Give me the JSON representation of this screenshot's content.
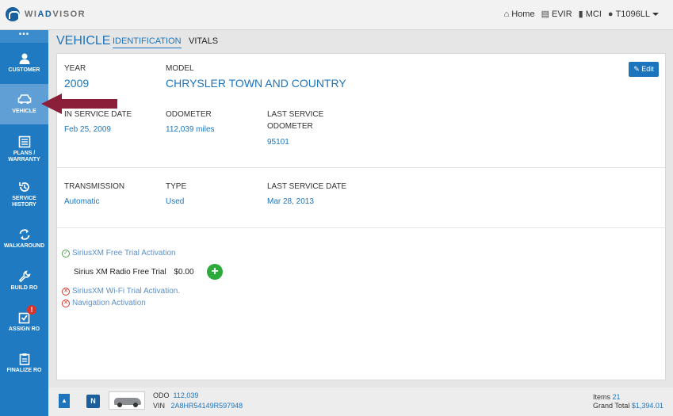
{
  "brand": {
    "name_prefix": "WI",
    "name_accent": "AD",
    "name_suffix": "VISOR"
  },
  "topnav": {
    "home": "Home",
    "evir": "EVIR",
    "mci": "MCI",
    "user": "T1096LL"
  },
  "sidebar": {
    "dots": "•••",
    "items": [
      {
        "label": "CUSTOMER",
        "icon": "person-icon"
      },
      {
        "label": "VEHICLE",
        "icon": "car-icon"
      },
      {
        "label": "PLANS / WARRANTY",
        "icon": "list-icon"
      },
      {
        "label": "SERVICE HISTORY",
        "icon": "history-icon"
      },
      {
        "label": "WALKAROUND",
        "icon": "refresh-icon"
      },
      {
        "label": "BUILD RO",
        "icon": "wrench-icon"
      },
      {
        "label": "ASSIGN RO",
        "icon": "checkbox-icon",
        "badge": "!"
      },
      {
        "label": "FINALIZE RO",
        "icon": "clipboard-icon"
      }
    ]
  },
  "header": {
    "title": "VEHICLE",
    "tabs": [
      "IDENTIFICATION",
      "VITALS"
    ]
  },
  "vehicle": {
    "year_label": "YEAR",
    "year": "2009",
    "model_label": "MODEL",
    "model": "CHRYSLER TOWN AND COUNTRY",
    "edit": "Edit",
    "in_service_label": "IN SERVICE DATE",
    "in_service": "Feb 25, 2009",
    "odometer_label": "ODOMETER",
    "odometer": "112,039 miles",
    "last_service_odo_label": "LAST SERVICE ODOMETER",
    "last_service_odo": "95101",
    "transmission_label": "TRANSMISSION",
    "transmission": "Automatic",
    "type_label": "TYPE",
    "type": "Used",
    "last_service_date_label": "LAST SERVICE DATE",
    "last_service_date": "Mar 28, 2013"
  },
  "activations": {
    "sirius_trial": "SiriusXM Free Trial Activation",
    "radio_item": "Sirius XM Radio Free Trial",
    "radio_price": "$0.00",
    "wifi_trial": "SiriusXM Wi-Fi Trial Activation.",
    "navigation": "Navigation Activation"
  },
  "footer": {
    "odo_label": "ODO",
    "odo": "112,039",
    "vin_label": "VIN",
    "vin": "2A8HR54149R597948",
    "items_label": "Items",
    "items": "21",
    "total_label": "Grand Total",
    "total": "$1,394.01",
    "n": "N"
  },
  "colors": {
    "accent": "#1c75bc",
    "sidebar": "#1f7ac2",
    "arrow": "#8b1f3a",
    "success": "#2daa3c",
    "danger": "#d9342b"
  }
}
